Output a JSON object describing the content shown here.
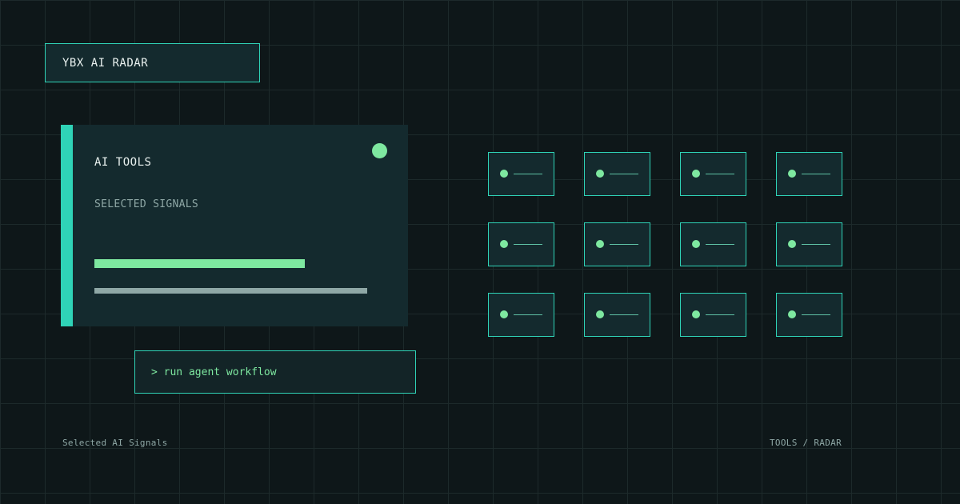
{
  "brand": {
    "title": "YBX AI RADAR"
  },
  "card": {
    "title": "AI TOOLS",
    "subtitle": "SELECTED SIGNALS",
    "primary_bar_level": 0.77
  },
  "command": {
    "text": "> run agent workflow"
  },
  "tiles": {
    "rows": 3,
    "columns": 4
  },
  "footer": {
    "left": "Selected AI Signals",
    "right": "TOOLS / RADAR"
  },
  "colors": {
    "background": "#0e1719",
    "panel": "#142a2e",
    "accent_teal": "#2fd3b7",
    "accent_green": "#7ee8a0",
    "muted_text": "#8ea7a5"
  }
}
